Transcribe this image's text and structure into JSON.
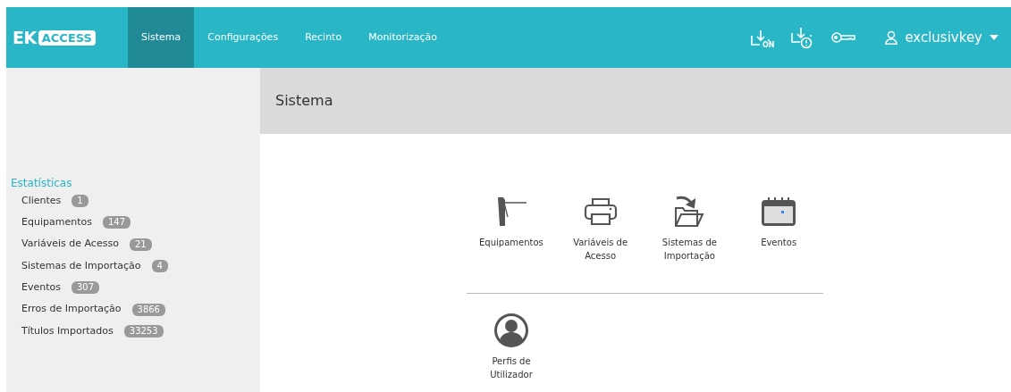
{
  "logo": {
    "mark": "EK",
    "word": "ACCESS"
  },
  "nav": [
    {
      "label": "Sistema",
      "selected": true
    },
    {
      "label": "Configurações",
      "selected": false
    },
    {
      "label": "Recinto",
      "selected": false
    },
    {
      "label": "Monitorização",
      "selected": false
    }
  ],
  "toolbar": [
    {
      "kind": "download-on",
      "text": "ON"
    },
    {
      "kind": "download-alert"
    },
    {
      "kind": "key"
    }
  ],
  "user": {
    "name": "exclusivkey"
  },
  "sidebar": {
    "title": "Estatísticas",
    "items": [
      {
        "label": "Clientes",
        "count": "1"
      },
      {
        "label": "Equipamentos",
        "count": "147"
      },
      {
        "label": "Variáveis de Acesso",
        "count": "21"
      },
      {
        "label": "Sistemas de Importação",
        "count": "4"
      },
      {
        "label": "Eventos",
        "count": "307"
      },
      {
        "label": "Erros de Importação",
        "count": "3866"
      },
      {
        "label": "Títulos Importados",
        "count": "33253"
      }
    ]
  },
  "page_title": "Sistema",
  "tile_groups": [
    [
      {
        "kind": "turnstile",
        "label": "Equipamentos"
      },
      {
        "kind": "printer",
        "label": "Variáveis de Acesso"
      },
      {
        "kind": "folder",
        "label": "Sistemas de Importação"
      },
      {
        "kind": "calendar",
        "label": "Eventos"
      }
    ],
    [
      {
        "kind": "user",
        "label": "Perfis de Utilizador"
      }
    ]
  ]
}
